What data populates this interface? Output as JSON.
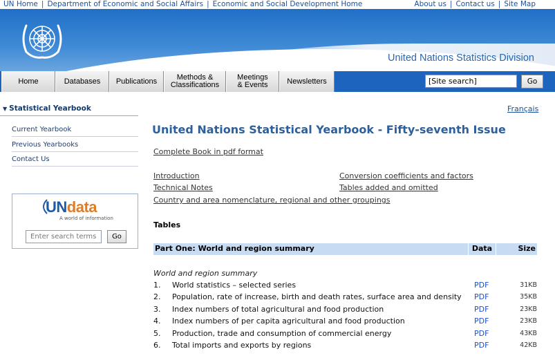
{
  "topbar": {
    "un_home": "UN Home",
    "desa": "Department of Economic and Social Affairs",
    "esd_home": "Economic and Social Development Home",
    "about": "About us",
    "contact": "Contact us",
    "sitemap": "Site Map"
  },
  "header": {
    "division": "United Nations Statistics Division"
  },
  "nav": {
    "tabs": [
      "Home",
      "Databases",
      "Publications",
      "Methods &\nClassifications",
      "Meetings\n& Events",
      "Newsletters"
    ],
    "search_value": "[Site search]",
    "go_label": "Go"
  },
  "sidebar": {
    "title": "Statistical Yearbook",
    "items": [
      "Current Yearbook",
      "Previous Yearbooks",
      "Contact Us"
    ],
    "undata": {
      "logo_un": "UN",
      "logo_data": "data",
      "tagline": "A world of information",
      "search_placeholder": "Enter search terms",
      "go_label": "Go"
    }
  },
  "main": {
    "language_link": "Français",
    "title": "United Nations Statistical Yearbook - Fifty-seventh Issue",
    "complete_book": "Complete Book in pdf format",
    "links_left": [
      "Introduction",
      "Technical Notes"
    ],
    "links_right": [
      "Conversion coefficients and factors",
      "Tables added and omitted"
    ],
    "nomenclature": "Country and area nomenclature, regional and other groupings",
    "tables_heading": "Tables",
    "table_header": {
      "part": "Part One: World and region summary",
      "data": "Data",
      "size": "Size"
    },
    "section_label": "World and region summary",
    "rows": [
      {
        "num": "1.",
        "name": "World statistics – selected series",
        "link": "PDF",
        "size": "31KB"
      },
      {
        "num": "2.",
        "name": "Population, rate of increase, birth and death rates, surface area and density",
        "link": "PDF",
        "size": "35KB"
      },
      {
        "num": "3.",
        "name": "Index numbers of total agricultural and food production",
        "link": "PDF",
        "size": "23KB"
      },
      {
        "num": "4.",
        "name": "Index numbers of per capita agricultural and food production",
        "link": "PDF",
        "size": "23KB"
      },
      {
        "num": "5.",
        "name": "Production, trade and consumption of commercial energy",
        "link": "PDF",
        "size": "43KB"
      },
      {
        "num": "6.",
        "name": "Total imports and exports by regions",
        "link": "PDF",
        "size": "42KB"
      }
    ]
  }
}
